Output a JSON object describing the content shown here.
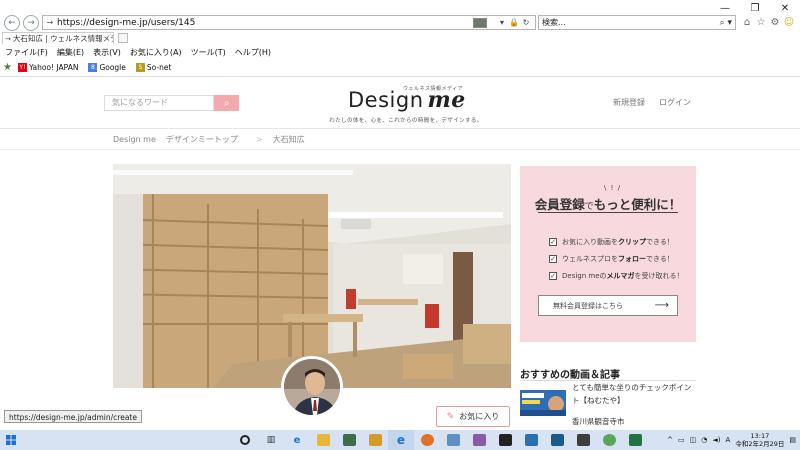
{
  "browser": {
    "window_controls": [
      "—",
      "❐",
      "✕"
    ],
    "url": "https://design-me.jp/users/145",
    "search_placeholder": "検索...",
    "tab_title": "大石知広 | ウェルネス情報メデ...",
    "menu": [
      "ファイル(F)",
      "編集(E)",
      "表示(V)",
      "お気に入り(A)",
      "ツール(T)",
      "ヘルプ(H)"
    ],
    "favorites": [
      {
        "label": "Yahoo! JAPAN",
        "color": "#e60012",
        "glyph": "Y!"
      },
      {
        "label": "Google",
        "color": "#4a7fe0",
        "glyph": "8"
      },
      {
        "label": "So-net",
        "color": "#b79a1f",
        "glyph": "S"
      }
    ],
    "status_url": "https://design-me.jp/admin/create"
  },
  "site": {
    "search_placeholder": "気になるワード",
    "logo_sub": "ウェルネス情報メディア",
    "logo_main": "Design",
    "logo_me": "me",
    "tagline": "わたしの体を、心を、これからの時間を、デザインする。",
    "signup_link": "新規登録",
    "login_link": "ログイン",
    "breadcrumb": [
      "Design me",
      "デザインミートップ",
      "大石知広"
    ],
    "breadcrumb_sep": ">",
    "favorite_button": "お気に入り",
    "promo": {
      "title_a": "会員登録",
      "title_b": "で",
      "title_c": "もっと便利に！",
      "items": [
        {
          "pre": "お気に入り動画を",
          "bold": "クリップ",
          "post": "できる！"
        },
        {
          "pre": "ウェルネスプロを",
          "bold": "フォロー",
          "post": "できる！"
        },
        {
          "pre": "Design meの",
          "bold": "メルマガ",
          "post": "を受け取れる！"
        }
      ],
      "button": "無料会員登録はこちら"
    },
    "recommended": {
      "title": "おすすめの動画＆記事",
      "item1": "とても簡単な坐りのチェックポイント【ねむたや】",
      "item2": "香川県観音寺市"
    }
  },
  "taskbar": {
    "time": "13:17",
    "date": "令和2年2月29日",
    "lang": "A"
  },
  "colors": {
    "accent_pink": "#f3a9ae",
    "promo_bg": "#f8d9de",
    "taskbar_bg": "#d7e3f2"
  }
}
